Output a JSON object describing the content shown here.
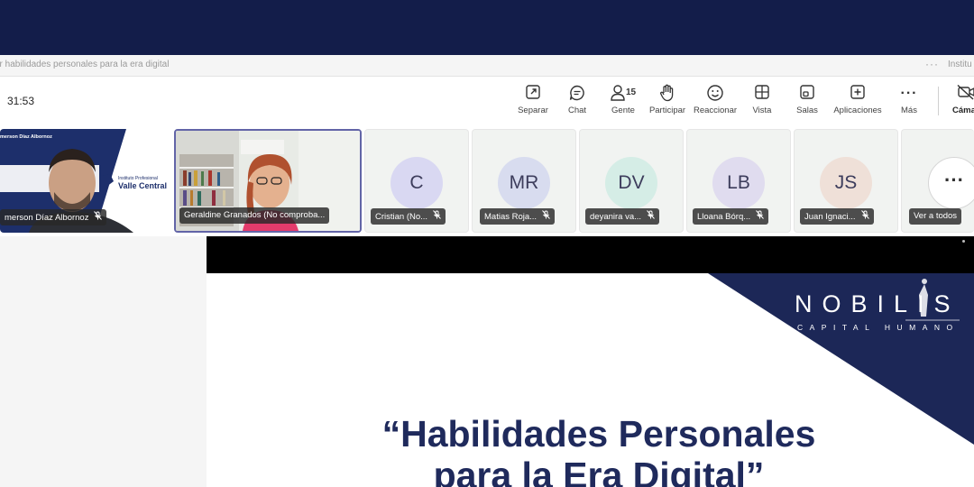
{
  "window": {
    "title_left": "ar habilidades personales para la era digital",
    "title_right": "Institu"
  },
  "toolbar": {
    "timer": "31:53",
    "people_count": "15",
    "buttons": [
      {
        "label": "Separar",
        "icon": "pop-out-icon"
      },
      {
        "label": "Chat",
        "icon": "chat-icon"
      },
      {
        "label": "Gente",
        "icon": "people-icon"
      },
      {
        "label": "Participar",
        "icon": "raise-hand-icon"
      },
      {
        "label": "Reaccionar",
        "icon": "smiley-icon"
      },
      {
        "label": "Vista",
        "icon": "grid-view-icon"
      },
      {
        "label": "Salas",
        "icon": "rooms-icon"
      },
      {
        "label": "Aplicaciones",
        "icon": "add-apps-icon"
      },
      {
        "label": "Más",
        "icon": "more-icon"
      },
      {
        "label": "Cáma",
        "icon": "camera-off-icon"
      }
    ]
  },
  "participants": [
    {
      "name": "merson Díaz Albornoz",
      "video": true,
      "background_text": {
        "line1": "merson Díaz Albornoz",
        "line2": "Instituto Profesional",
        "line3": "Valle Central"
      }
    },
    {
      "name": "Geraldine Granados (No comproba...",
      "video": true
    },
    {
      "name": "Cristian (No...",
      "initials": "C",
      "avatar_color": "#d9d8f2"
    },
    {
      "name": "Matias Roja...",
      "initials": "MR",
      "avatar_color": "#d8dcef"
    },
    {
      "name": "deyanira va...",
      "initials": "DV",
      "avatar_color": "#d5ede6"
    },
    {
      "name": "Lloana Bórq...",
      "initials": "LB",
      "avatar_color": "#e0dcef"
    },
    {
      "name": "Juan Ignaci...",
      "initials": "JS",
      "avatar_color": "#efe0d8"
    }
  ],
  "see_all": {
    "label": "Ver a todos",
    "icon": "more-icon"
  },
  "slide": {
    "logo_word": "NOBILIS",
    "logo_sub": "CAPITAL HUMANO",
    "title": "“Habilidades Personales para la Era Digital”"
  },
  "colors": {
    "header_navy": "#131d4a",
    "slide_navy": "#1f2a5c",
    "accent_purple": "#6264a7"
  }
}
